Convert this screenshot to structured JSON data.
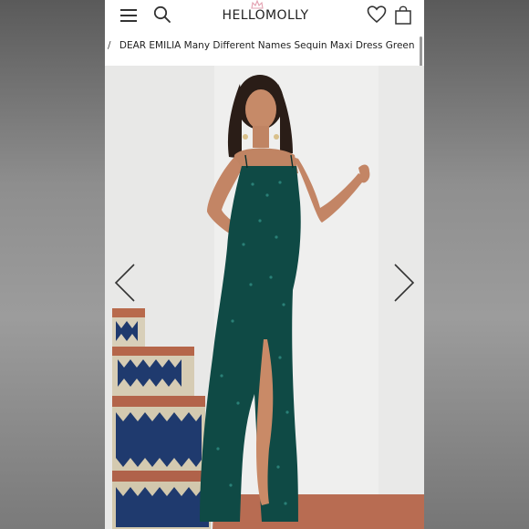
{
  "header": {
    "logo_text": "HELLOMOLLY"
  },
  "breadcrumb": {
    "separator": "/",
    "current": "DEAR EMILIA Many Different Names Sequin Maxi Dress Green"
  },
  "product": {
    "dress_color": "#0f4a45",
    "image_description_icon": "model-photo"
  },
  "icons": {
    "menu": "hamburger-icon",
    "search": "search-icon",
    "wishlist": "heart-icon",
    "cart": "shopping-bag-icon",
    "prev": "chevron-left-icon",
    "next": "chevron-right-icon"
  },
  "colors": {
    "brand_crown": "#e3a0b0",
    "text": "#222222"
  }
}
